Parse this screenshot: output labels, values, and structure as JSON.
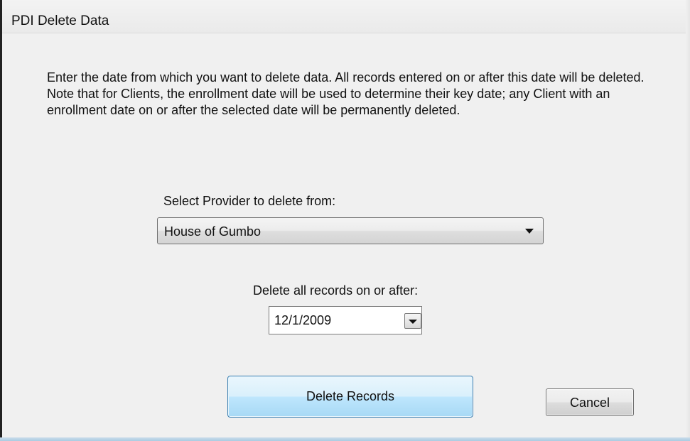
{
  "window": {
    "title": "PDI Delete Data"
  },
  "instructions": {
    "text": "Enter the date from which you want to delete data. All records entered on or after this date will be deleted. Note that for Clients, the enrollment date will be used to determine their key date; any Client with an enrollment date on or after the selected date will be permanently deleted."
  },
  "provider": {
    "label": "Select Provider to delete from:",
    "selected": "House of Gumbo",
    "icon": "chevron-down-icon"
  },
  "date": {
    "label": "Delete all records on or after:",
    "value": "12/1/2009",
    "icon": "calendar-dropdown-icon"
  },
  "buttons": {
    "delete_label": "Delete Records",
    "cancel_label": "Cancel"
  },
  "colors": {
    "window_bg": "#f0f0f0",
    "focus_button_border": "#3c7fb1",
    "focus_button_fill": "#bee6fd",
    "bottom_edge": "#aacbe2"
  }
}
